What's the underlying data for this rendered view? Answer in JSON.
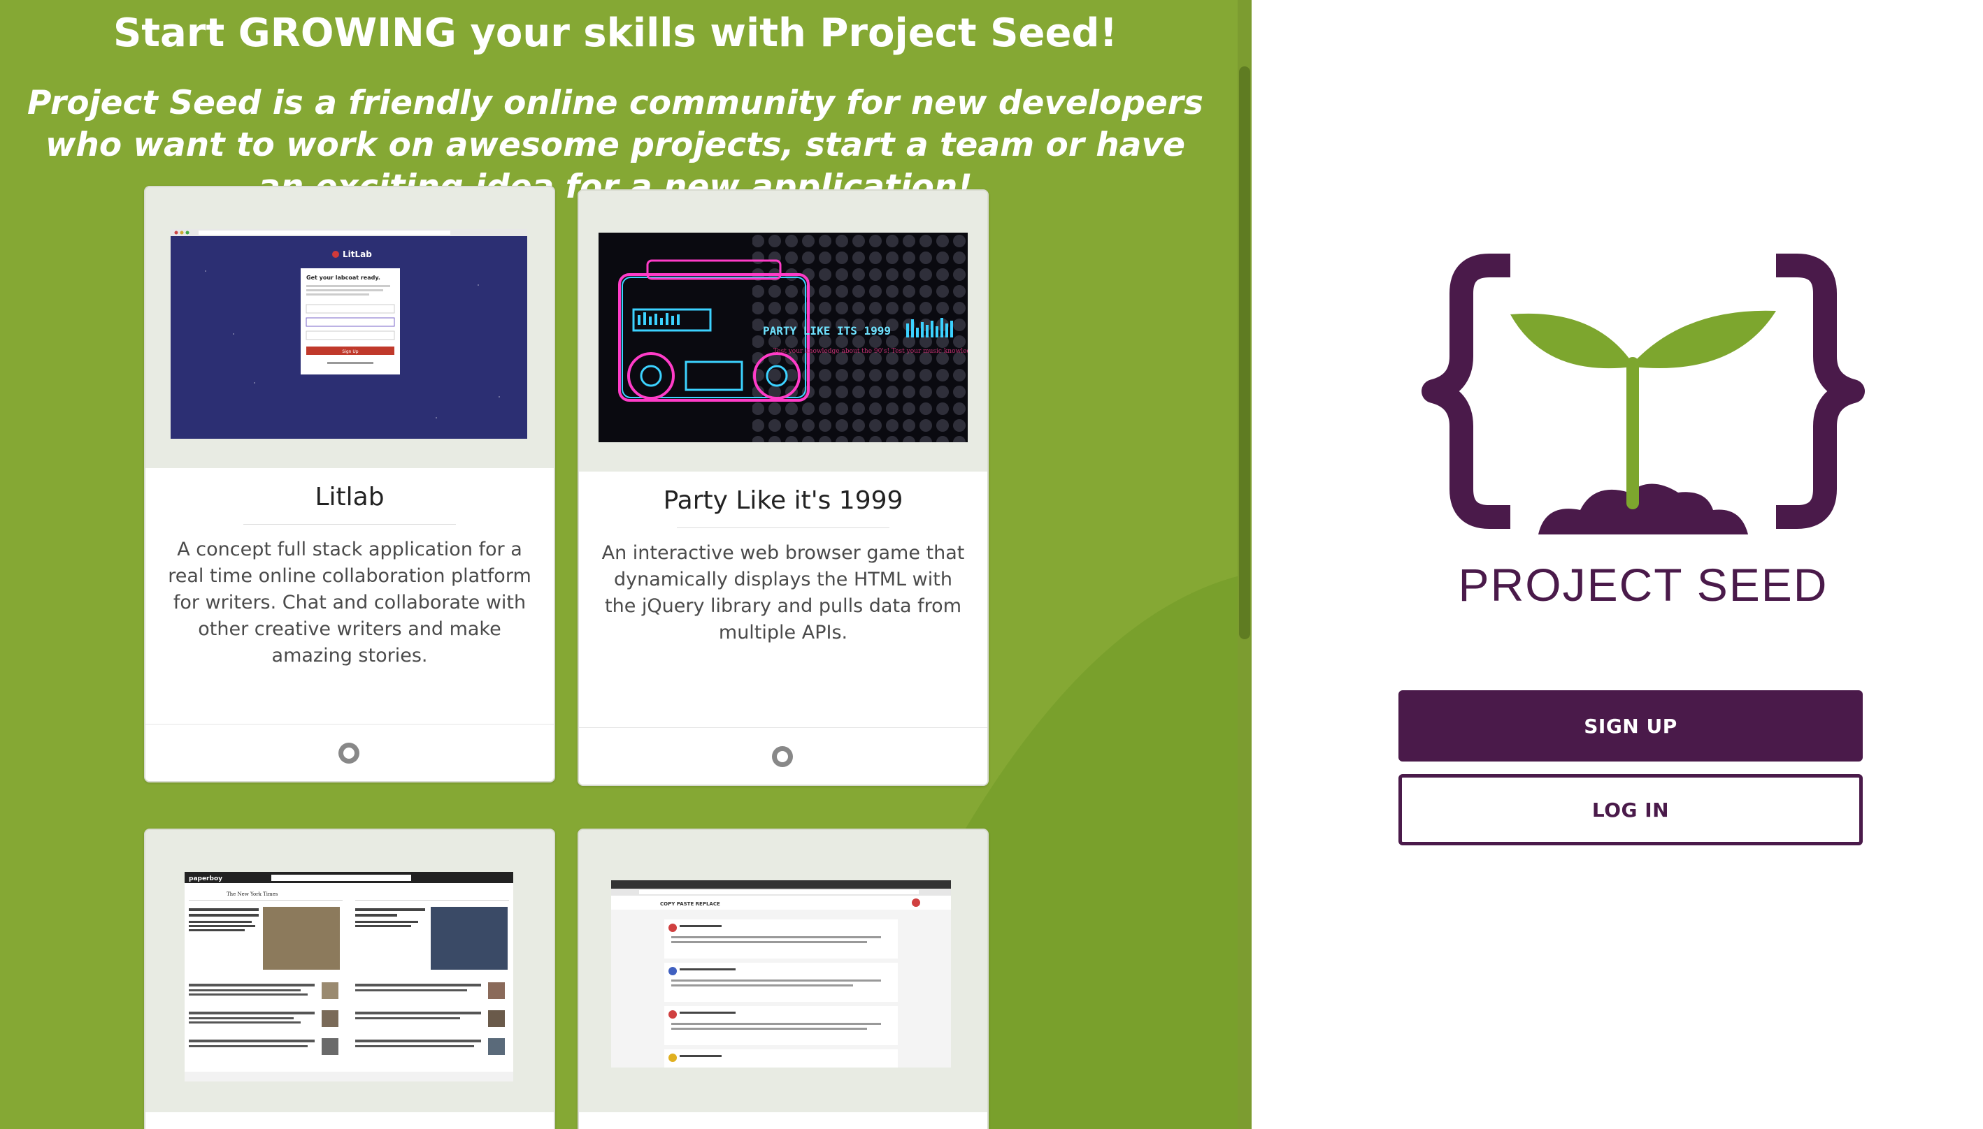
{
  "hero": {
    "headline": "Start GROWING your skills with Project Seed!",
    "subhead": "Project Seed is a friendly online community for new developers who want to work on awesome projects, start a team or have an exciting idea for a new application!"
  },
  "projects": [
    {
      "title": "Litlab",
      "description": "A concept full stack application for a real time online collaboration platform for writers. Chat and collaborate with other creative writers and make amazing stories.",
      "thumb": {
        "brand": "LitLab",
        "heading": "Get your labcoat ready.",
        "button": "Sign Up"
      },
      "footer_icon": "github-icon"
    },
    {
      "title": "Party Like it's 1999",
      "description": "An interactive web browser game that dynamically displays the HTML with the jQuery library and pulls data from multiple APIs.",
      "thumb": {
        "banner": "PARTY LIKE ITS 1999",
        "tagline": "Test your knowledge about the 90's! Test your music knowledge here!"
      },
      "footer_icon": "github-icon"
    },
    {
      "thumb": {
        "brand": "paperboy",
        "masthead": "The New York Times"
      }
    },
    {
      "thumb": {
        "brand": "COPY PASTE REPLACE"
      }
    }
  ],
  "brand": {
    "logo_text": "PROJECT SEED",
    "colors": {
      "green": "#85a834",
      "purple": "#4a1a4a",
      "leaf": "#7da62e"
    }
  },
  "auth": {
    "signup_label": "SIGN UP",
    "login_label": "LOG IN"
  }
}
